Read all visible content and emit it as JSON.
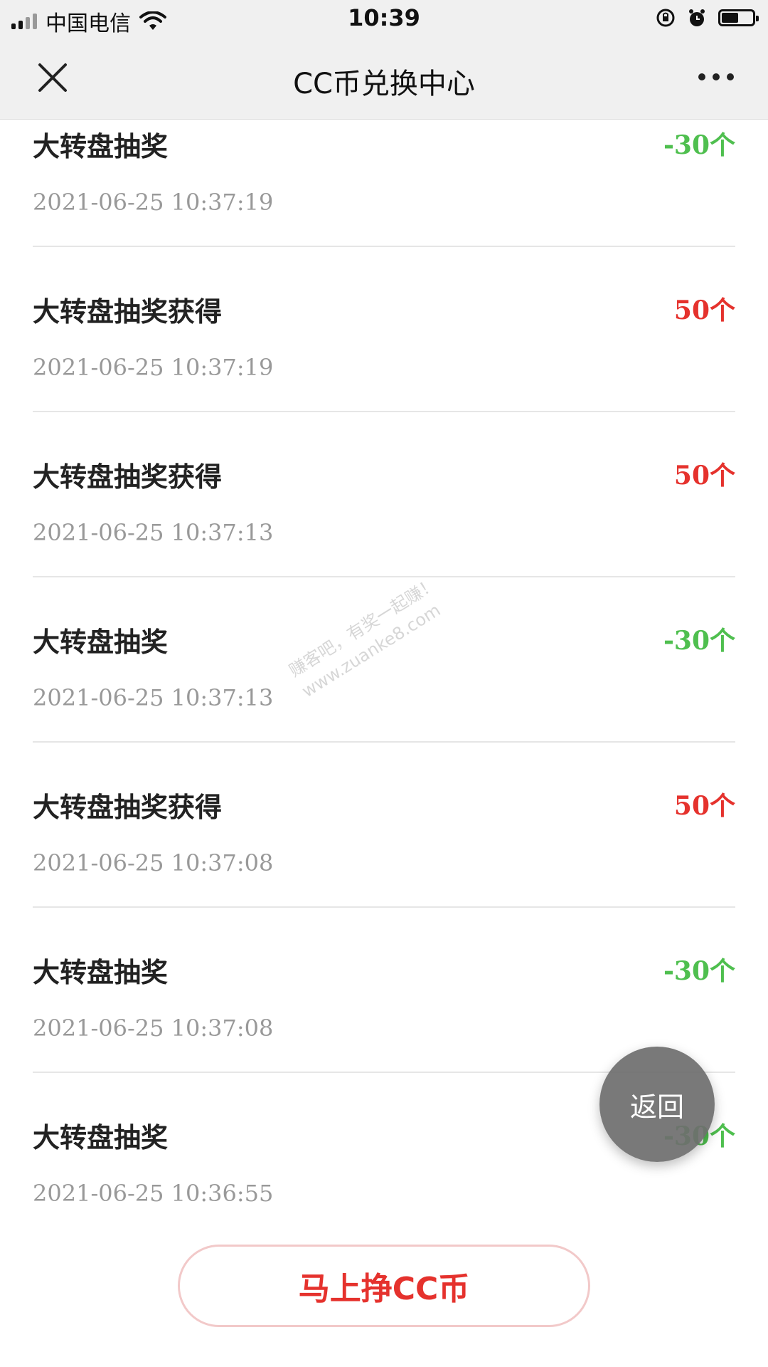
{
  "status_bar": {
    "carrier": "中国电信",
    "time": "10:39",
    "battery_level": 0.55
  },
  "nav": {
    "title": "CC币兑换中心"
  },
  "records": [
    {
      "title": "大转盘抽奖",
      "amount": "-30个",
      "type": "neg",
      "time": "2021-06-25 10:37:19"
    },
    {
      "title": "大转盘抽奖获得",
      "amount": "50个",
      "type": "pos",
      "time": "2021-06-25 10:37:19"
    },
    {
      "title": "大转盘抽奖获得",
      "amount": "50个",
      "type": "pos",
      "time": "2021-06-25 10:37:13"
    },
    {
      "title": "大转盘抽奖",
      "amount": "-30个",
      "type": "neg",
      "time": "2021-06-25 10:37:13"
    },
    {
      "title": "大转盘抽奖获得",
      "amount": "50个",
      "type": "pos",
      "time": "2021-06-25 10:37:08"
    },
    {
      "title": "大转盘抽奖",
      "amount": "-30个",
      "type": "neg",
      "time": "2021-06-25 10:37:08"
    },
    {
      "title": "大转盘抽奖",
      "amount": "-30个",
      "type": "neg",
      "time": "2021-06-25 10:36:55"
    }
  ],
  "watermark": {
    "line1": "赚客吧，有奖一起赚！",
    "line2": "www.zuanke8.com"
  },
  "floating_back": {
    "label": "返回"
  },
  "bottom_button": {
    "label": "马上挣CC币"
  },
  "colors": {
    "positive": "#e5322d",
    "negative": "#4fbf4f",
    "nav_bg": "#f0f0f0"
  }
}
